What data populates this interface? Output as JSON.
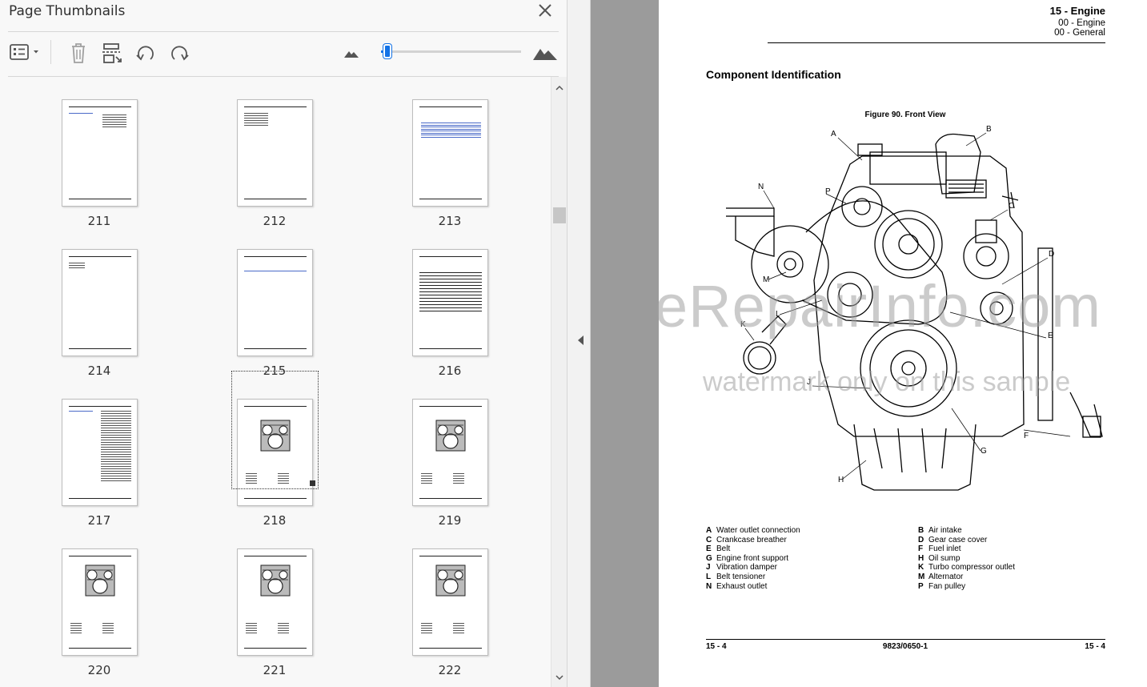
{
  "panel": {
    "title": "Page Thumbnails",
    "close_icon": "close-icon"
  },
  "toolbar": {
    "options_icon": "thumbnail-options-icon",
    "delete_icon": "trash-icon",
    "extract_icon": "extract-pages-icon",
    "undo_icon": "rotate-counterclockwise-icon",
    "redo_icon": "rotate-clockwise-icon",
    "zoom_out_icon": "small-mountain-icon",
    "zoom_in_icon": "large-mountain-icon",
    "thumbnail_size_fraction": 0.03,
    "accent_color": "#1473e6"
  },
  "thumbnails": [
    {
      "page": "211"
    },
    {
      "page": "212"
    },
    {
      "page": "213"
    },
    {
      "page": "214"
    },
    {
      "page": "215"
    },
    {
      "page": "216"
    },
    {
      "page": "217"
    },
    {
      "page": "218",
      "selected": true
    },
    {
      "page": "219"
    },
    {
      "page": "220"
    },
    {
      "page": "221"
    },
    {
      "page": "222"
    }
  ],
  "document": {
    "header_title": "15 - Engine",
    "header_sub1": "00 - Engine",
    "header_sub2": "00 - General",
    "section_heading": "Component Identification",
    "figure_caption": "Figure 90. Front View",
    "callouts": [
      "A",
      "B",
      "C",
      "D",
      "E",
      "F",
      "G",
      "H",
      "J",
      "K",
      "L",
      "M",
      "N",
      "P"
    ],
    "legend_left": [
      {
        "key": "A",
        "text": "Water outlet connection"
      },
      {
        "key": "C",
        "text": "Crankcase breather"
      },
      {
        "key": "E",
        "text": "Belt"
      },
      {
        "key": "G",
        "text": "Engine front support"
      },
      {
        "key": "J",
        "text": "Vibration damper"
      },
      {
        "key": "L",
        "text": "Belt tensioner"
      },
      {
        "key": "N",
        "text": "Exhaust outlet"
      }
    ],
    "legend_right": [
      {
        "key": "B",
        "text": "Air intake"
      },
      {
        "key": "D",
        "text": "Gear case cover"
      },
      {
        "key": "F",
        "text": "Fuel inlet"
      },
      {
        "key": "H",
        "text": "Oil sump"
      },
      {
        "key": "K",
        "text": "Turbo compressor outlet"
      },
      {
        "key": "M",
        "text": "Alternator"
      },
      {
        "key": "P",
        "text": "Fan pulley"
      }
    ],
    "footer_left": "15 - 4",
    "footer_mid": "9823/0650-1",
    "footer_right": "15 - 4",
    "watermark_1": "eRepairInfo.com",
    "watermark_2": "watermark only on this sample"
  }
}
